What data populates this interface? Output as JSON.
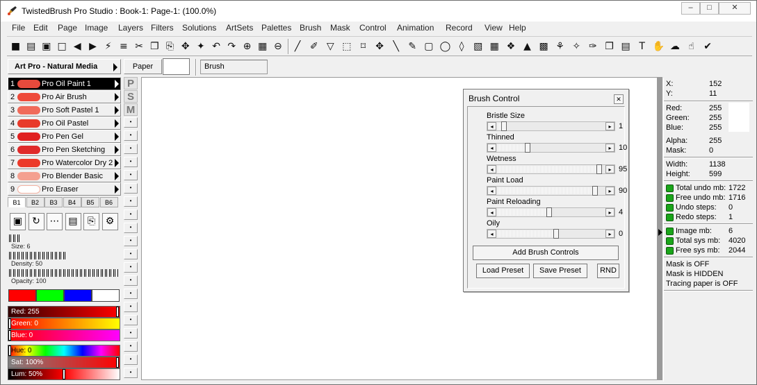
{
  "window": {
    "title": "TwistedBrush Pro Studio : Book-1: Page-1:  (100.0%)",
    "controls": {
      "minimize": "–",
      "maximize": "□",
      "close": "✕"
    }
  },
  "menu": [
    "File",
    "Edit",
    "Page",
    "Image",
    "Layers",
    "Filters",
    "Solutions",
    "ArtSets",
    "Palettes",
    "Brush",
    "Mask",
    "Control",
    "Animation",
    "Record",
    "View",
    "Help"
  ],
  "toolbar_icons": [
    "save-icon",
    "book-icon",
    "page-add-icon",
    "page-icon",
    "page-prev-icon",
    "page-next-icon",
    "brush-fx-icon",
    "copy-page-icon",
    "cut-icon",
    "copy-icon",
    "paste-icon",
    "paste-special-icon",
    "paste-layer-icon",
    "undo-icon",
    "redo-icon",
    "zoom-in-icon",
    "actual-size-icon",
    "zoom-out-icon",
    "brush-icon",
    "eyedropper-icon",
    "bucket-icon",
    "marquee-icon",
    "crop-icon",
    "move-icon",
    "line-icon",
    "pen-icon",
    "rectangle-icon",
    "ellipse-icon",
    "fill-icon",
    "pattern-icon",
    "grid-icon",
    "pattern2-icon",
    "mountain-icon",
    "checker-icon",
    "stamp-icon",
    "wand-icon",
    "pencils-icon",
    "copy-brush-icon",
    "layers-icon",
    "text-icon",
    "hand-icon",
    "sponge-icon",
    "smudge-icon",
    "tubes-icon"
  ],
  "artset": {
    "title": "Art Pro - Natural Media"
  },
  "paper": {
    "label": "Paper"
  },
  "brush_field": {
    "value": "Brush"
  },
  "brushes": [
    {
      "num": "1",
      "name": "Pro Oil Paint 1",
      "color": "#e84a3c",
      "selected": true
    },
    {
      "num": "2",
      "name": "Pro Air Brush",
      "color": "#ee4a3a",
      "selected": false
    },
    {
      "num": "3",
      "name": "Pro Soft Pastel 1",
      "color": "#f06a5a",
      "selected": false
    },
    {
      "num": "4",
      "name": "Pro Oil Pastel",
      "color": "#e83a2a",
      "selected": false
    },
    {
      "num": "5",
      "name": "Pro Pen Gel",
      "color": "#e02020",
      "selected": false
    },
    {
      "num": "6",
      "name": "Pro Pen Sketching",
      "color": "#e02a2a",
      "selected": false
    },
    {
      "num": "7",
      "name": "Pro Watercolor Dry 2",
      "color": "#ec3a2a",
      "selected": false
    },
    {
      "num": "8",
      "name": "Pro Blender Basic",
      "color": "#f4a090",
      "selected": false
    },
    {
      "num": "9",
      "name": "Pro Eraser",
      "color": "#ffffff",
      "selected": false
    }
  ],
  "banks": [
    "B1",
    "B2",
    "B3",
    "B4",
    "B5",
    "B6"
  ],
  "brush_tools": [
    "page-tool-icon",
    "reload-tool-icon",
    "dots-tool-icon",
    "stack-tool-icon",
    "paste-tool-icon",
    "settings-tool-icon"
  ],
  "sliders": {
    "size": "Size: 6",
    "density": "Density: 50",
    "opacity": "Opacity: 100"
  },
  "color_boxes": [
    "#ff0000",
    "#00ff00",
    "#0000ff",
    "#ffffff"
  ],
  "rgb_bars": {
    "red": "Red: 255",
    "green": "Green: 0",
    "blue": "Blue: 0"
  },
  "hsl_bars": {
    "hue": "Hue: 0",
    "sat": "Sat: 100%",
    "lum": "Lum: 50%"
  },
  "psm": [
    "P",
    "S",
    "M"
  ],
  "dialog": {
    "title": "Brush Control",
    "close": "✕",
    "controls": [
      {
        "label": "Bristle Size",
        "value": "1",
        "fraction": 0.04
      },
      {
        "label": "Thinned",
        "value": "10",
        "fraction": 0.27
      },
      {
        "label": "Wetness",
        "value": "95",
        "fraction": 0.97
      },
      {
        "label": "Paint Load",
        "value": "90",
        "fraction": 0.93
      },
      {
        "label": "Paint Reloading",
        "value": "4",
        "fraction": 0.48
      },
      {
        "label": "Oily",
        "value": "0",
        "fraction": 0.55
      }
    ],
    "add_button": "Add Brush Controls",
    "load_button": "Load Preset",
    "save_button": "Save Preset",
    "rnd_button": "RND"
  },
  "info": {
    "x_label": "X:",
    "x": "152",
    "y_label": "Y:",
    "y": "11",
    "red_label": "Red:",
    "red": "255",
    "green_label": "Green:",
    "green": "255",
    "blue_label": "Blue:",
    "blue": "255",
    "alpha_label": "Alpha:",
    "alpha": "255",
    "mask_label": "Mask:",
    "mask": "0",
    "width_label": "Width:",
    "width": "1138",
    "height_label": "Height:",
    "height": "599",
    "total_undo_label": "Total undo mb:",
    "total_undo": "1722",
    "free_undo_label": "Free undo mb:",
    "free_undo": "1716",
    "undo_steps_label": "Undo steps:",
    "undo_steps": "0",
    "redo_steps_label": "Redo steps:",
    "redo_steps": "1",
    "image_mb_label": "Image mb:",
    "image_mb": "6",
    "total_sys_label": "Total sys mb:",
    "total_sys": "4020",
    "free_sys_label": "Free sys mb:",
    "free_sys": "2044",
    "mask_off": "Mask is OFF",
    "mask_hidden": "Mask is HIDDEN",
    "tracing": "Tracing paper is OFF"
  }
}
